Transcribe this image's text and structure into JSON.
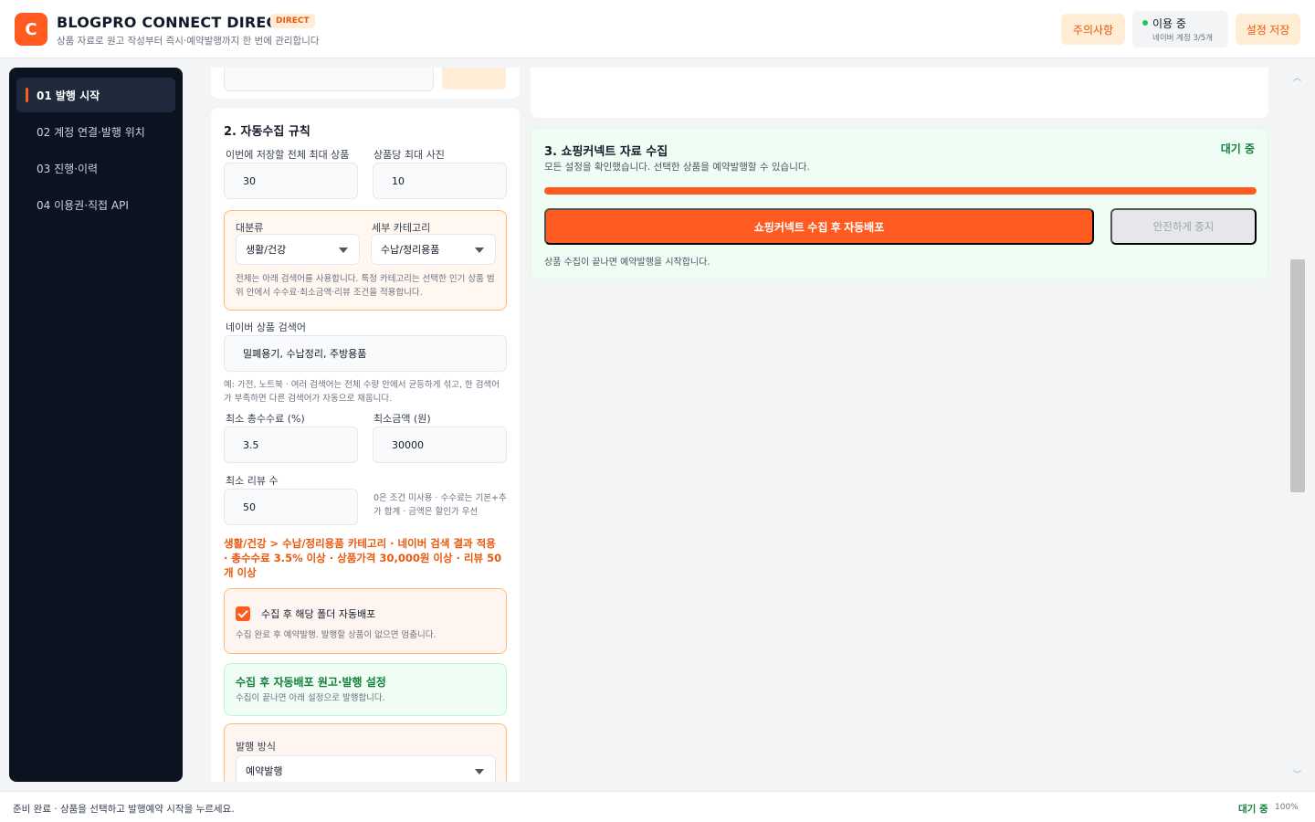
{
  "header": {
    "logo_letter": "C",
    "title": "BLOGPRO CONNECT DIRECT",
    "badge": "DIRECT",
    "subtitle": "상품 자료로 원고 작성부터 즉시·예약발행까지 한 번에 관리합니다",
    "notice_label": "주의사항",
    "status_label": "이용 중",
    "status_sub": "네이버 계정 3/5개",
    "save_label": "설정 저장"
  },
  "sidebar": {
    "items": [
      {
        "label": "01  발행 시작",
        "active": true
      },
      {
        "label": "02  계정 연결·발행 위치",
        "active": false
      },
      {
        "label": "03  진행·이력",
        "active": false
      },
      {
        "label": "04  이용권·직접 API",
        "active": false
      }
    ]
  },
  "rules": {
    "title": "2. 자동수집 규칙",
    "max_products_label": "이번에 저장할 전체 최대 상품",
    "max_products_value": "30",
    "max_photos_label": "상품당 최대 사진",
    "max_photos_value": "10",
    "major_label": "대분류",
    "major_value": "생활/건강",
    "sub_label": "세부 카테고리",
    "sub_value": "수납/정리용품",
    "category_note": "전체는 아래 검색어를 사용합니다. 특정 카테고리는 선택한 인기 상품 범위 안에서 수수료·최소금액·리뷰 조건을 적용합니다.",
    "keyword_label": "네이버 상품 검색어",
    "keyword_value": "밀폐용기, 수납정리, 주방용품",
    "keyword_note": "예: 가전, 노트북 · 여러 검색어는 전체 수량 안에서 균등하게 섞고, 한 검색어가 부족하면 다른 검색어가 자동으로 채웁니다.",
    "commission_label": "최소 총수수료 (%)",
    "commission_value": "3.5",
    "min_price_label": "최소금액 (원)",
    "min_price_value": "30000",
    "min_review_label": "최소 리뷰 수",
    "min_review_value": "50",
    "review_note": "0은 조건 미사용 · 수수료는 기본+추가 합계 · 금액은 할인가 우선",
    "summary": "생활/건강 > 수납/정리용품 카테고리 · 네이버 검색 결과 적용 · 총수수료 3.5% 이상 · 상품가격 30,000원 이상 · 리뷰 50개 이상",
    "auto_deploy_label": "수집 후 해당 폴더 자동배포",
    "auto_deploy_checked": true,
    "auto_deploy_note": "수집 완료 후 예약발행. 발행할 상품이 없으면 멈춥니다.",
    "post_title": "수집 후 자동배포 원고·발행 설정",
    "post_note": "수집이 끝나면 아래 설정으로 발행합니다.",
    "publish_mode_label": "발행 방식",
    "publish_mode_value": "예약발행"
  },
  "collect": {
    "title": "3. 쇼핑커넥트 자료 수집",
    "status": "대기 중",
    "subtitle": "모든 설정을 확인했습니다. 선택한 상품을 예약발행할 수 있습니다.",
    "progress": 1.0,
    "primary_button": "쇼핑커넥트 수집 후 자동배포",
    "stop_button": "안전하게 중지",
    "footnote": "상품 수집이 끝나면 예약발행을 시작합니다."
  },
  "footer": {
    "message": "준비 완료 · 상품을 선택하고 발행예약 시작을 누르세요.",
    "status": "대기 중",
    "zoom": "100%"
  },
  "colors": {
    "accent": "#ff5a1f",
    "sidebar_bg": "#0b1220",
    "success": "#15803d"
  }
}
